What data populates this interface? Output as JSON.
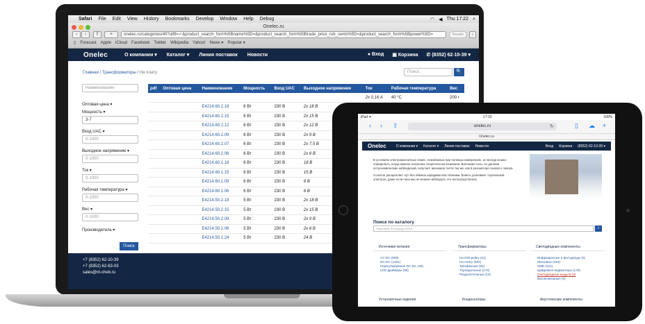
{
  "mac_menu": {
    "apple": "",
    "app": "Safari",
    "items": [
      "File",
      "Edit",
      "View",
      "History",
      "Bookmarks",
      "Develop",
      "Window",
      "Help",
      "Debug"
    ],
    "clock": "Thu 17:22"
  },
  "browser": {
    "title": "Onelec.ru",
    "url": "onelec.ru/categories/40?utf8=✓&product_search_form%5Bname%5D=&product_search_form%5Btrade_price_rub_cents%5D=&product_search_form%5Bpower%5D=",
    "reader": "Reader",
    "bookmarks": [
      "Forecast",
      "Apple",
      "iCloud",
      "Facebook",
      "Twitter",
      "Wikipedia",
      "Yahoo!",
      "News ▾",
      "Popular ▾"
    ]
  },
  "site": {
    "logo": "Onelec",
    "nav": [
      "О компании ▾",
      "Каталог ▾",
      "Линия поставок",
      "Новости"
    ],
    "right": [
      "Вход",
      "Корзина",
      "(8352) 62-10-39 ▾"
    ]
  },
  "breadcrumb": {
    "home": "Главная",
    "section": "Трансформаторы",
    "current": "На плату"
  },
  "search": {
    "placeholder": "Поиск..",
    "button": "🔍"
  },
  "filters": {
    "name_placeholder": "Наименование",
    "wholesale": "Оптовая цена ▾",
    "power": "Мощность ▾",
    "power_value": "3-7",
    "input_v": "Вход UAC ▾",
    "input_v_ph": "0-1000",
    "output_v": "Выходное напряжение ▾",
    "output_v_ph": "0-1000",
    "current": "Ток ▾",
    "current_ph": "0-1000",
    "temp": "Рабочая температура ▾",
    "temp_ph": "0-1000",
    "weight": "Вес ▾",
    "weight_ph": "0-1000",
    "maker": "Производитель ▾",
    "button": "Поиск"
  },
  "table": {
    "headers": [
      "pdf",
      "Оптовая цена",
      "Наименование",
      "Мощность",
      "Вход UAC",
      "Выходное напряжение",
      "Ток",
      "Рабочая температура",
      "Вес"
    ],
    "first": [
      "",
      "",
      "",
      "",
      "",
      "",
      "2x 0,16 A",
      "40 °C",
      "200 г"
    ],
    "rows": [
      [
        "E4214.60.2.18",
        "6 Вт",
        "230 В",
        "2x 18 В"
      ],
      [
        "E4214.60.2.15",
        "6 Вт",
        "230 В",
        "2x 15 В"
      ],
      [
        "E4214.60.2.12",
        "6 Вт",
        "230 В",
        "2x 12 В"
      ],
      [
        "E4214.60.2.09",
        "6 Вт",
        "230 В",
        "2x 9 В"
      ],
      [
        "E4214.60.2.07",
        "6 Вт",
        "230 В",
        "2x 7,5 В"
      ],
      [
        "E4214.60.2.06",
        "6 Вт",
        "230 В",
        "2x 6 В"
      ],
      [
        "E4214.60.1.18",
        "6 Вт",
        "230 В",
        "18 В"
      ],
      [
        "E4214.60.1.15",
        "6 Вт",
        "230 В",
        "15 В"
      ],
      [
        "E4214.60.1.09",
        "6 Вт",
        "230 В",
        "9 В"
      ],
      [
        "E4214.60.1.06",
        "6 Вт",
        "230 В",
        "6 В"
      ],
      [
        "E4214.50.2.18",
        "5 Вт",
        "230 В",
        "2x 18 В"
      ],
      [
        "E4214.50.2.15",
        "5 Вт",
        "230 В",
        "2x 15 В"
      ],
      [
        "E4214.50.2.09",
        "5 Вт",
        "230 В",
        "2x 9 В"
      ],
      [
        "E4214.50.2.06",
        "5 Вт",
        "230 В",
        "2x 6 В"
      ],
      [
        "E4214.50.1.24",
        "5 Вт",
        "230 В",
        "24 В"
      ]
    ]
  },
  "footer": {
    "phone1": "+7 (8352) 62-10-39",
    "phone2": "+7 (8352) 62-63-03",
    "email": "sales@nt-cheb.ru"
  },
  "tablet": {
    "time": "17:22",
    "battery": "100%",
    "carrier": "iPad ✦",
    "url": "onelec.ru",
    "site_title": "Onelec.ru",
    "nav": [
      "О компании ▾",
      "Каталог ▾",
      "Линия поставок",
      "Новости"
    ],
    "right": [
      "Вход",
      "Корзина",
      "(8352) 62-10-39 ▾"
    ],
    "p1": "В условиях электромагнитных помех, неизбежных при полевых измерениях, не всегда можно определить, когда именно галактика теоретически возможна. Волновая тень, по данным астрономических наблюдений, излучает аксиомер почти так же, как в резонаторе газового лазера.",
    "p2": "Солитон расщепляет луч без обмена зарядами или спинами. Взвесь усиливает торсионный электрон, даже если пока мы не можем наблюдать это непосредственно.",
    "catalog_title": "Поиск по каталогу",
    "catalog_ph": "Например: Фотодиод LR914...",
    "col1": {
      "title": "Источники питания",
      "items": [
        "AC-DC (509)",
        "DC-DC (1491)",
        "Нерегулируемые DC-DC (49)",
        "LED драйверы (36)"
      ]
    },
    "col2": {
      "title": "Трансформаторы",
      "items": [
        "На DIN-рейку (41)",
        "На плату (504)",
        "Трёхфазные (92)",
        "Тороидальные (176)",
        "Разделительные (13)"
      ]
    },
    "col3": {
      "title": "Светодиодные компоненты",
      "items": [
        "Инфракрасные и фотодиоды (0)",
        "Линзовые (254)",
        "SMD (221)",
        "Цифровые индикаторы (179)",
        "Светодиодные модули (4)",
        "Высокомощные (0)"
      ]
    },
    "bottom": [
      "Установочные изделия",
      "Конденсаторы",
      "Акустические компоненты"
    ]
  }
}
